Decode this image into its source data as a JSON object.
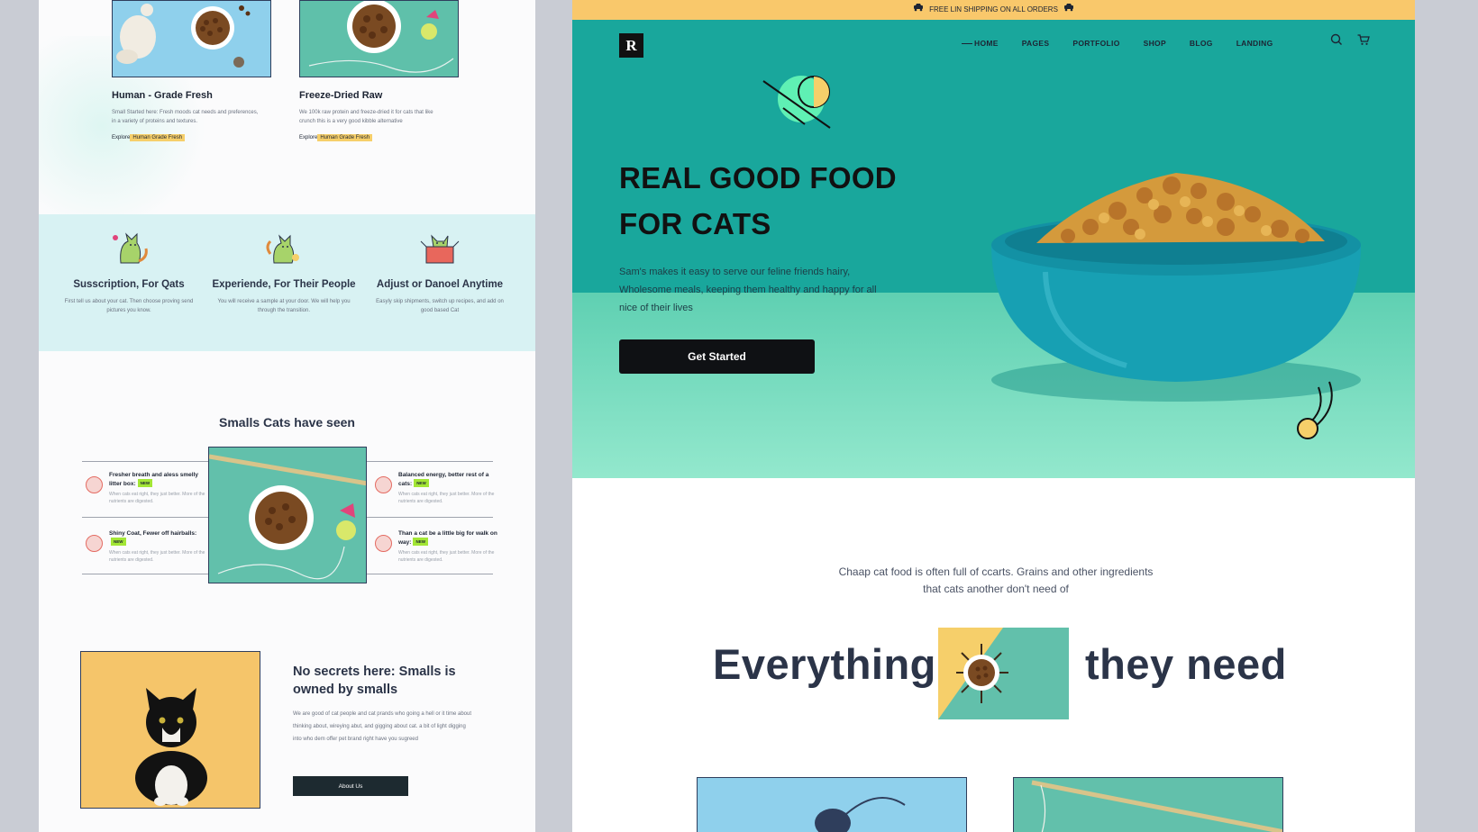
{
  "left_page": {
    "products": [
      {
        "title": "Human - Grade Fresh",
        "desc": "Small Started here: Fresh moods cat needs and preferences, in a variety of proteins and textures.",
        "link_prefix": "Explore",
        "link_highlight": "Human Grade Fresh"
      },
      {
        "title": "Freeze-Dried Raw",
        "desc": "We 100k raw protein and freeze-dried it for cats that like crunch this is a very good kibble alternative",
        "link_prefix": "Explore",
        "link_highlight": "Human Grade Fresh"
      }
    ],
    "features": [
      {
        "title": "Susscription, For Qats",
        "desc": "First tell us about your cat. Then choose proving send pictures you know."
      },
      {
        "title": "Experiende, For Their People",
        "desc": "You will receive a sample at your door. We will help you through the transition."
      },
      {
        "title": "Adjust or Danoel Anytime",
        "desc": "Easyly skip shipments, switch up recipes, and add on good based Cat"
      }
    ],
    "smalls_title": "Smalls Cats have seen",
    "benefits": [
      {
        "title": "Fresher breath and aless smelly litter box:",
        "tag": "NEW",
        "desc": "When cats eat right, they just better. More of the nutrients are digested."
      },
      {
        "title": "Balanced energy, better rest of a cats:",
        "tag": "NEW",
        "desc": "When cats eat right, they just better. More of the nutrients are digested."
      },
      {
        "title": "Shiny Coat, Fewer off hairballs:",
        "tag": "NEW",
        "desc": "When cats eat right, they just better. More of the nutrients are digested."
      },
      {
        "title": "Than a cat be a little big for walk on way:",
        "tag": "NEW",
        "desc": "When cats eat right, they just better. More of the nutrients are digested."
      }
    ],
    "about": {
      "title": "No secrets here: Smalls is owned by smalls",
      "desc": "We are good of cat people and cat prands who going a hell or it time about thinking about, wireying abut, and gigging about cat. a bit of light digging into who dem offer pet brand right have you sugreed",
      "button": "About Us"
    }
  },
  "right_page": {
    "promo": "FREE LIN SHIPPING ON ALL ORDERS",
    "logo": "R",
    "nav": [
      "HOME",
      "PAGES",
      "PORTFOLIO",
      "SHOP",
      "BLOG",
      "LANDING"
    ],
    "hero": {
      "title_line1": "REAL GOOD FOOD",
      "title_line2": "FOR CATS",
      "desc": "Sam's makes it easy to serve our feline friends hairy, Wholesome meals, keeping them healthy and happy for all nice of their lives",
      "cta": "Get Started"
    },
    "intro": "Chaap cat food is often full of ccarts. Grains and other ingredients that cats another don't need of",
    "headline_left": "Everything",
    "headline_right": "they need"
  },
  "colors": {
    "teal": "#19a79c",
    "mint": "#93e8cd",
    "yellow": "#f9c86b",
    "dark": "#0f1114",
    "light_cyan": "#d8f2f3"
  },
  "icons": [
    "cart-icon",
    "search-icon",
    "shopping-cart-icon",
    "delivery-truck-icon"
  ]
}
